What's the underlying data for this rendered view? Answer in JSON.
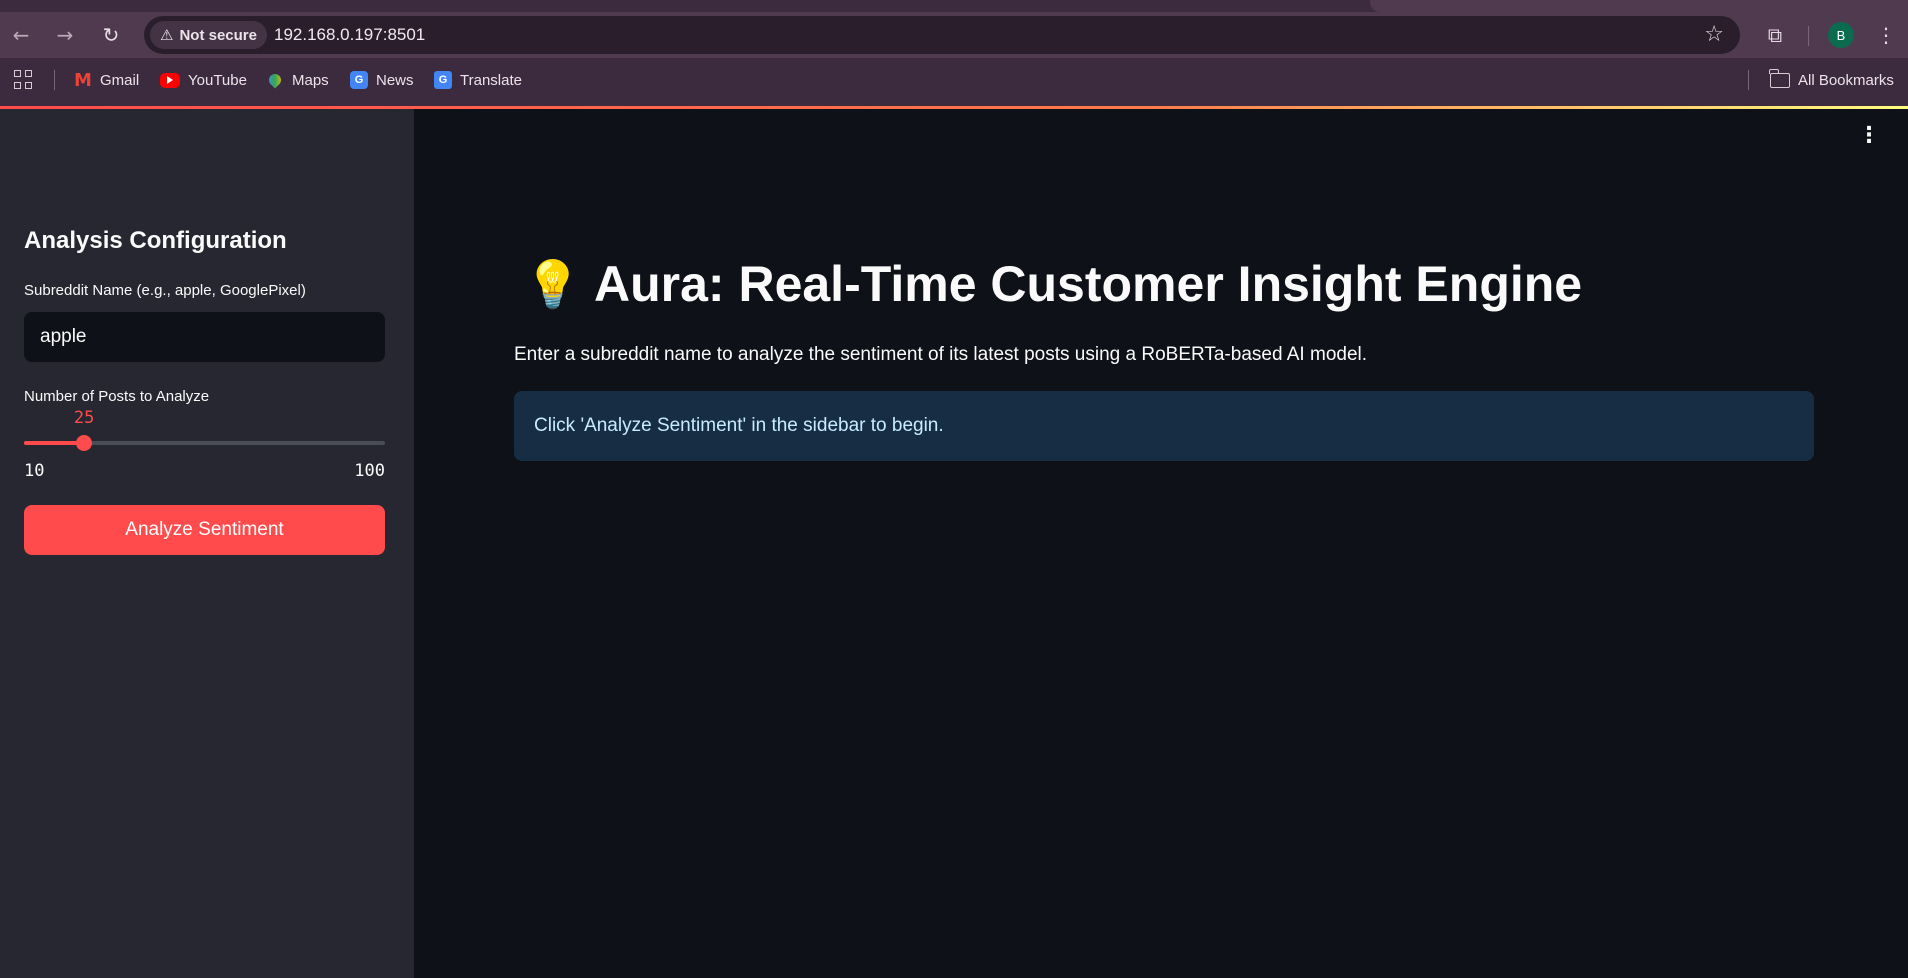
{
  "browser": {
    "security_label": "Not secure",
    "url": "192.168.0.197:8501",
    "profile_initial": "B",
    "bookmarks": [
      {
        "label": "Gmail",
        "icon": "gmail-icon"
      },
      {
        "label": "YouTube",
        "icon": "youtube-icon"
      },
      {
        "label": "Maps",
        "icon": "maps-icon"
      },
      {
        "label": "News",
        "icon": "news-icon"
      },
      {
        "label": "Translate",
        "icon": "translate-icon"
      }
    ],
    "all_bookmarks_label": "All Bookmarks"
  },
  "sidebar": {
    "title": "Analysis Configuration",
    "subreddit_label": "Subreddit Name (e.g., apple, GooglePixel)",
    "subreddit_value": "apple",
    "posts_label": "Number of Posts to Analyze",
    "posts_value": "25",
    "posts_min": "10",
    "posts_max": "100",
    "posts_fraction": 0.1667,
    "analyze_button": "Analyze Sentiment"
  },
  "main": {
    "title_icon": "💡",
    "title": "Aura: Real-Time Customer Insight Engine",
    "description": "Enter a subreddit name to analyze the sentiment of its latest posts using a RoBERTa-based AI model.",
    "info_message": "Click 'Analyze Sentiment' in the sidebar to begin."
  },
  "colors": {
    "accent": "#ff4b4b",
    "sidebar_bg": "#262730",
    "main_bg": "#0e1117",
    "info_bg": "#172d43",
    "info_text": "#c7ebff"
  }
}
